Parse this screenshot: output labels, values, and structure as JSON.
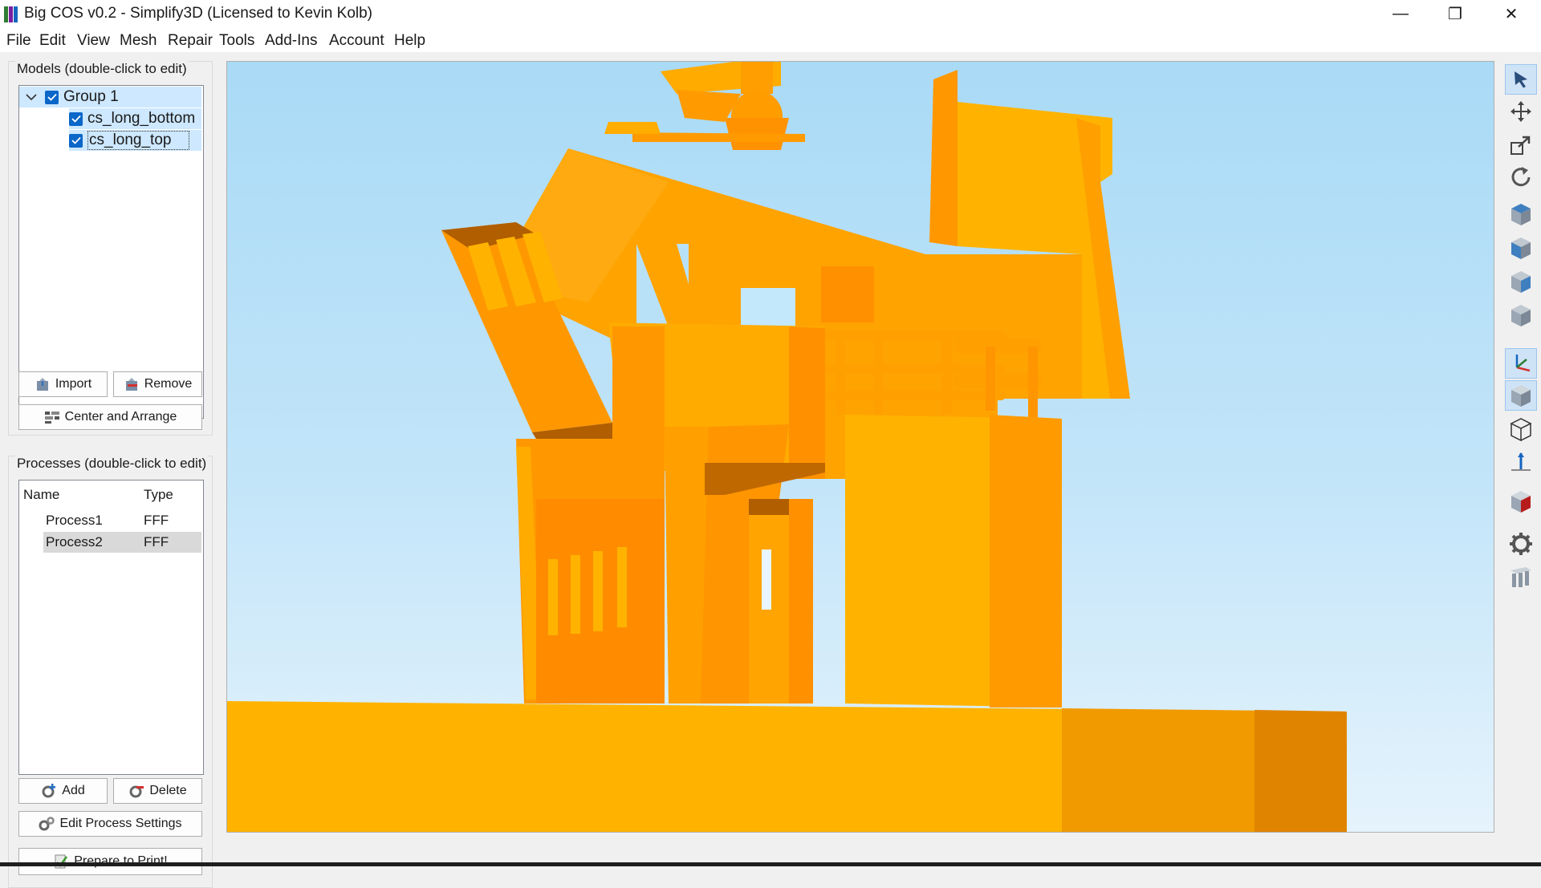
{
  "window": {
    "title": "Big COS v0.2 - Simplify3D (Licensed to Kevin Kolb)",
    "controls": {
      "minimize": "—",
      "restore": "❐",
      "close": "✕"
    }
  },
  "menu": [
    "File",
    "Edit",
    "View",
    "Mesh",
    "Repair",
    "Tools",
    "Add-Ins",
    "Account",
    "Help"
  ],
  "models": {
    "label": "Models (double-click to edit)",
    "group": {
      "name": "Group 1",
      "checked": true,
      "expanded": true
    },
    "items": [
      {
        "name": "cs_long_bottom",
        "checked": true
      },
      {
        "name": "cs_long_top",
        "checked": true,
        "selected": true
      }
    ],
    "buttons": {
      "import": "Import",
      "remove": "Remove",
      "center": "Center and Arrange"
    }
  },
  "processes": {
    "label": "Processes (double-click to edit)",
    "columns": [
      "Name",
      "Type"
    ],
    "rows": [
      {
        "name": "Process1",
        "type": "FFF"
      },
      {
        "name": "Process2",
        "type": "FFF",
        "selected": true
      }
    ],
    "buttons": {
      "add": "Add",
      "delete": "Delete",
      "edit": "Edit Process Settings",
      "prepare": "Prepare to Print!"
    }
  },
  "toolbar": [
    {
      "name": "select-tool-icon",
      "active": true
    },
    {
      "name": "move-tool-icon"
    },
    {
      "name": "scale-tool-icon"
    },
    {
      "name": "rotate-tool-icon"
    },
    {
      "name": "view-top-icon"
    },
    {
      "name": "view-front-icon"
    },
    {
      "name": "view-left-icon"
    },
    {
      "name": "view-right-icon"
    },
    {
      "name": "axes-toggle-icon",
      "active": true
    },
    {
      "name": "solid-view-icon",
      "active": true
    },
    {
      "name": "wireframe-view-icon"
    },
    {
      "name": "build-axis-icon"
    },
    {
      "name": "cross-section-icon"
    },
    {
      "name": "settings-gear-icon"
    },
    {
      "name": "print-bed-icon"
    }
  ],
  "colors": {
    "model": "#ffb300",
    "selection": "#cde8ff",
    "accent": "#0a66c8",
    "sky_top": "#a9daf6",
    "sky_bottom": "#e5f3fc"
  }
}
